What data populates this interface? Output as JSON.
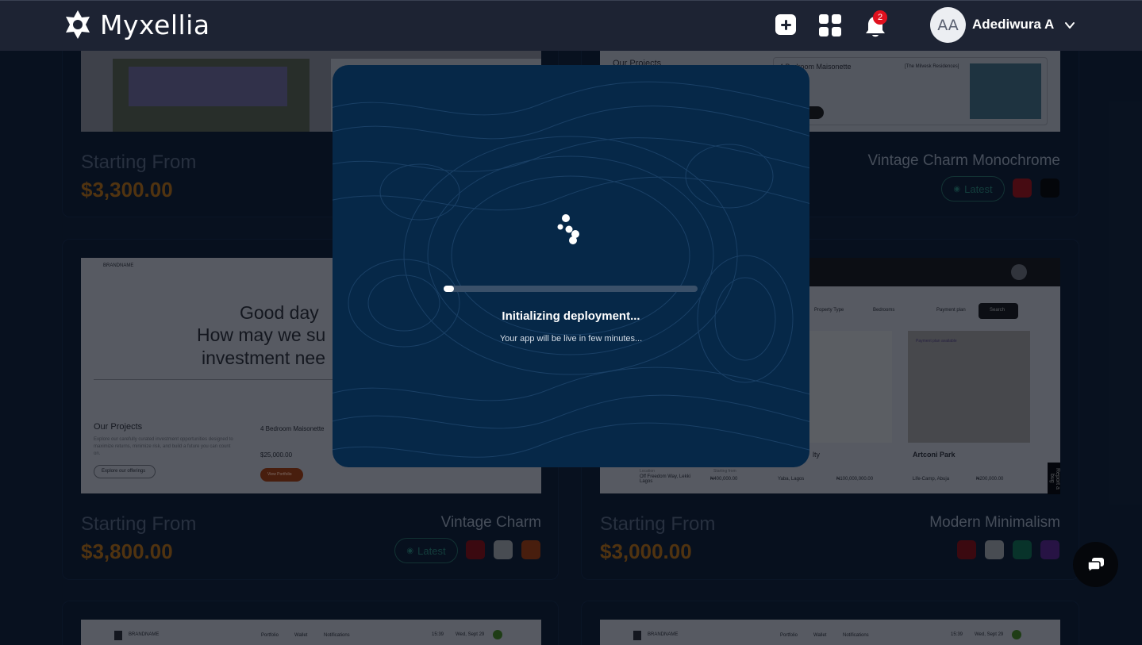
{
  "app": {
    "name": "Myxellia",
    "notifications_count": "2",
    "user_initials": "AA",
    "user_name": "Adediwura A"
  },
  "cards": [
    {
      "starting_label": "Starting From",
      "price": "$3,300.00",
      "thumbnail_text": []
    },
    {
      "theme_name": "Vintage Charm Monochrome",
      "latest_label": "Latest",
      "swatches": [
        "#6b0d12",
        "#050505"
      ],
      "thumbnail_text": [
        "Our Projects",
        "4 Bedroom Maisonette",
        "[The Milvesk Residences]"
      ]
    },
    {
      "starting_label": "Starting From",
      "price": "$3,800.00",
      "theme_name": "Vintage Charm",
      "latest_label": "Latest",
      "swatches": [
        "#5a0a0e",
        "#6e7074",
        "#6e2a0c"
      ],
      "thumbnail_text": [
        "BRANDNAME",
        "Good day",
        "How may we su",
        "investment nee",
        "Our Projects",
        "4 Bedroom Maisonette",
        "$25,000.00",
        "View Portfolio",
        "Explore our offerings",
        "Explore our carefully curated investment opportunities designed to maximize returns, minimize risk, and build a future you can count on."
      ]
    },
    {
      "starting_label": "Starting From",
      "price": "$3,000.00",
      "theme_name": "Modern Minimalism",
      "swatches": [
        "#5a0a0e",
        "#6e7074",
        "#0b4a36",
        "#3b1a5e"
      ],
      "thumbnail_text": [
        "Property Type",
        "Bedrooms",
        "Payment plan",
        "Search",
        "Payment plan available",
        "Artconi Park",
        "Location",
        "Off Freedom Way, Lekki Lagos",
        "Starting from",
        "₦400,000.00",
        "Yaba, Lagos",
        "₦100,000,000.00",
        "Life-Camp, Abuja",
        "₦200,000.00",
        "lty"
      ]
    },
    {
      "thumbnail_text": [
        "BRANDNAME",
        "Portfolio",
        "Wallet",
        "Notifications",
        "15:39",
        "Wed, Sept 29"
      ]
    },
    {
      "thumbnail_text": [
        "BRANDNAME",
        "Portfolio",
        "Wallet",
        "Notifications",
        "15:39",
        "Wed, Sept 29"
      ]
    }
  ],
  "modal": {
    "title": "Initializing deployment...",
    "subtitle": "Your app will be live in few minutes...",
    "progress_percent": 4
  },
  "report_bug_label": "Report a bug",
  "colors": {
    "topbar": "#1d2333",
    "modal_bg": "#062848",
    "price": "#7a4a0f",
    "badge": "#e0101e"
  }
}
